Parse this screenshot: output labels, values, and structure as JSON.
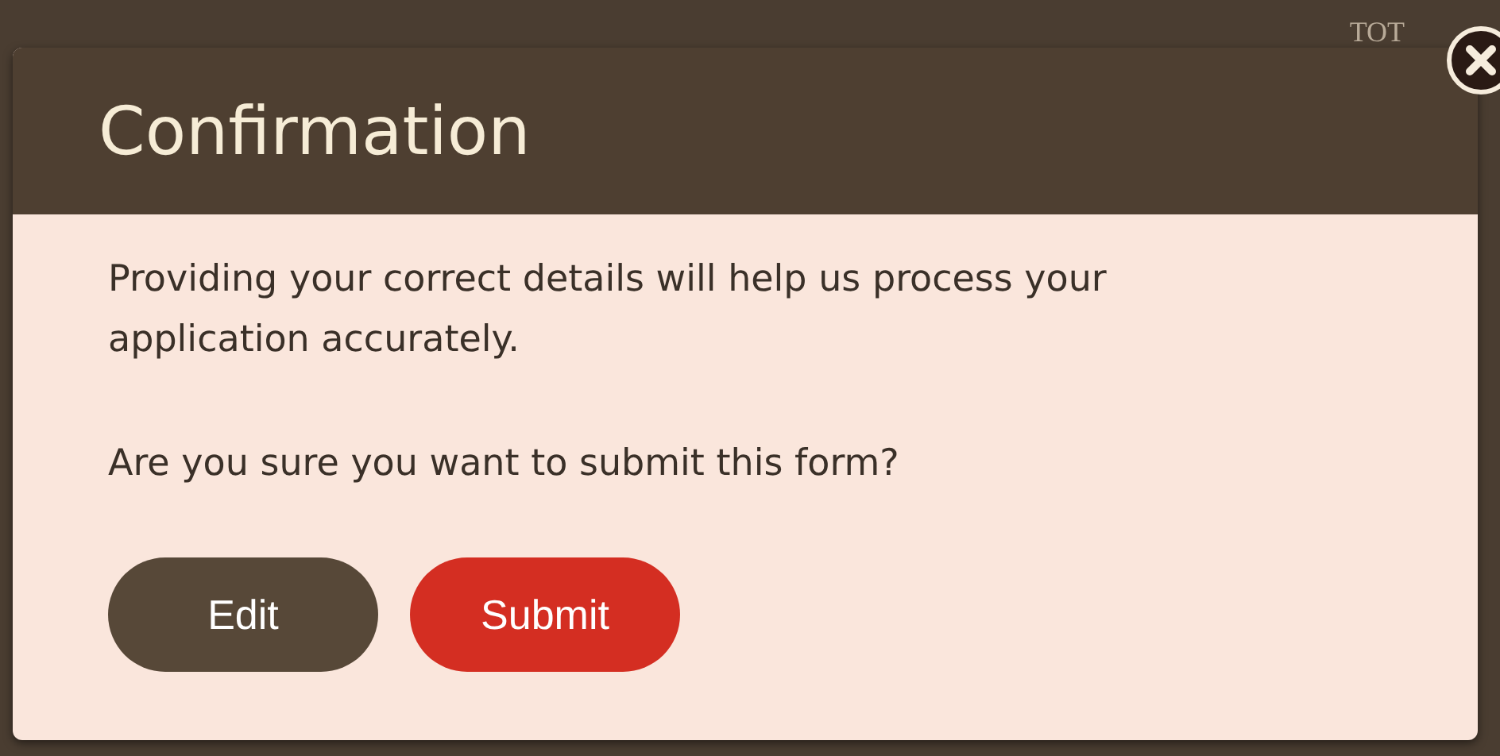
{
  "background": {
    "text": "TOT"
  },
  "dialog": {
    "title": "Confirmation",
    "paragraphs": [
      "Providing your correct details will help us process your application accurately.",
      "Are you sure you want to submit this form?"
    ],
    "buttons": [
      {
        "label": "Edit",
        "kind": "secondary"
      },
      {
        "label": "Submit",
        "kind": "primary"
      }
    ]
  }
}
